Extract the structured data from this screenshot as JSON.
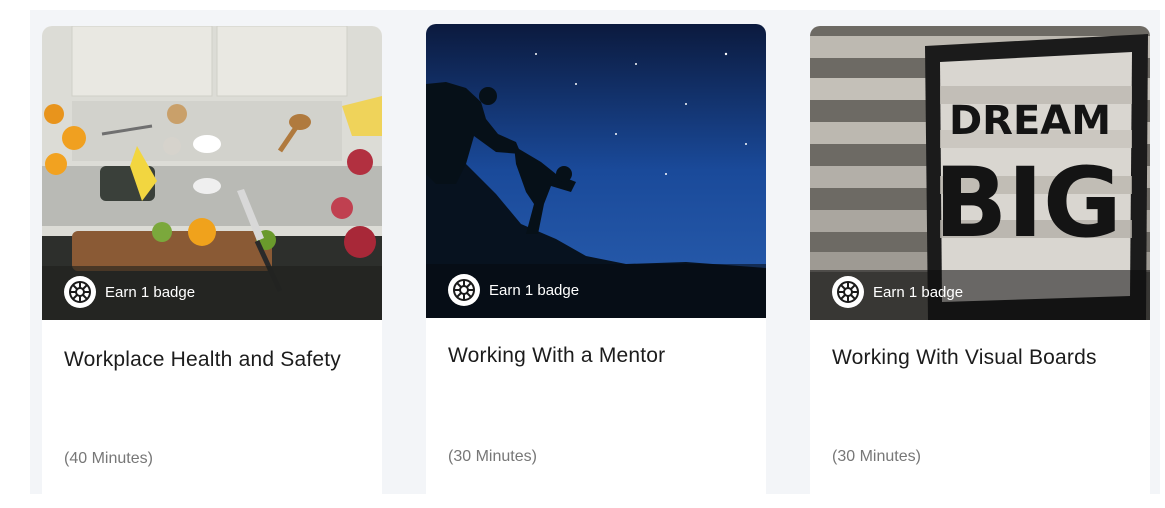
{
  "cards": [
    {
      "image_name": "kitchen-ingredients-image",
      "badge_icon": "imperial-crest-icon",
      "badge_label": "Earn 1 badge",
      "title": "Workplace Health and Safety",
      "duration": "(40 Minutes)"
    },
    {
      "image_name": "climbers-night-sky-image",
      "badge_icon": "imperial-crest-icon",
      "badge_label": "Earn 1 badge",
      "title": "Working With a Mentor",
      "duration": "(30 Minutes)"
    },
    {
      "image_name": "dream-big-sign-image",
      "badge_icon": "imperial-crest-icon",
      "badge_label": "Earn 1 badge",
      "title": "Working With Visual Boards",
      "duration": "(30 Minutes)",
      "sign_text_line1": "DREAM",
      "sign_text_line2": "BIG"
    }
  ],
  "colors": {
    "panel_background": "#f3f5f8",
    "title_text": "#1c1c1c",
    "duration_text": "#777777"
  }
}
